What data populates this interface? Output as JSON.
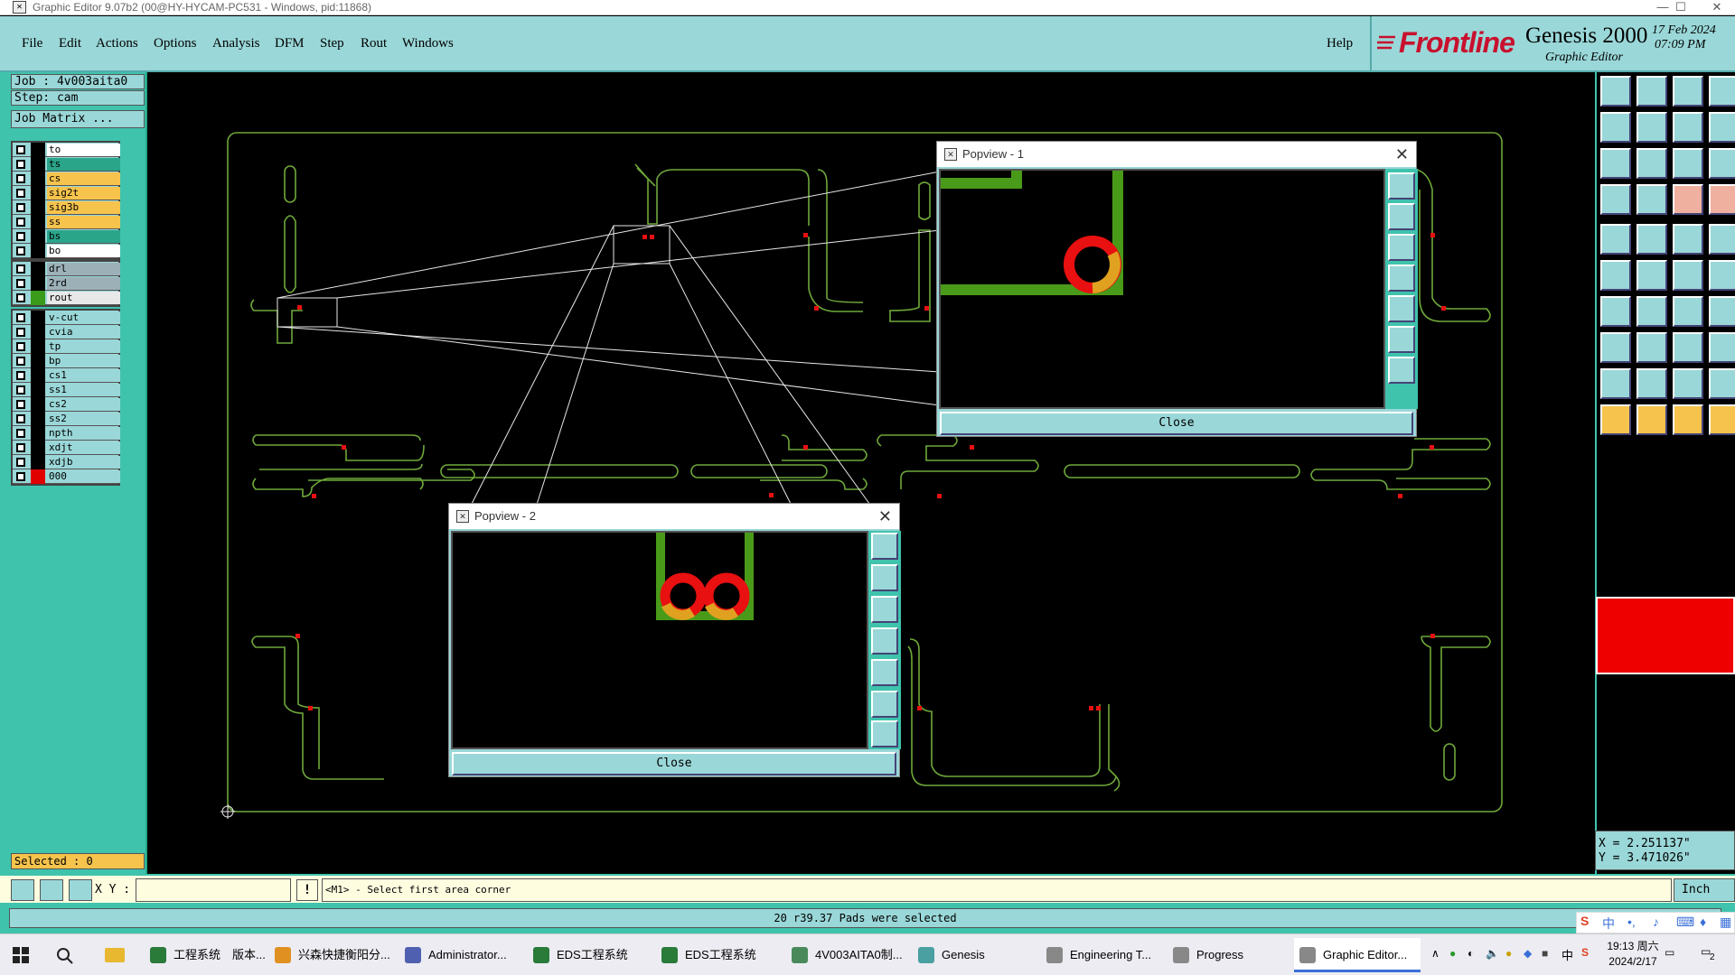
{
  "window": {
    "title": "Graphic Editor 9.07b2 (00@HY-HYCAM-PC531 - Windows, pid:11868)",
    "minimize": "—",
    "maximize": "☐",
    "close": "✕"
  },
  "menu": {
    "items": [
      "File",
      "Edit",
      "Actions",
      "Options",
      "Analysis",
      "DFM",
      "Step",
      "Rout",
      "Windows"
    ],
    "help": "Help"
  },
  "brand": {
    "logo": "Frontline",
    "product": "Genesis 2000",
    "subtitle": "Graphic Editor",
    "date": "17 Feb 2024",
    "time": "07:09 PM"
  },
  "job": {
    "job_line": "Job : 4v003aita0",
    "step_line": "Step: cam",
    "matrix_button": "Job Matrix ..."
  },
  "layers": {
    "group1": [
      {
        "name": "to",
        "color": "#ffffff"
      },
      {
        "name": "ts",
        "color": "#2aa58a"
      },
      {
        "name": "cs",
        "color": "#f6c34d"
      },
      {
        "name": "sig2t",
        "color": "#f6c34d"
      },
      {
        "name": "sig3b",
        "color": "#f6c34d"
      },
      {
        "name": "ss",
        "color": "#f6c34d"
      },
      {
        "name": "bs",
        "color": "#2aa58a"
      },
      {
        "name": "bo",
        "color": "#ffffff"
      }
    ],
    "group2": [
      {
        "name": "drl",
        "color": "#9cb0b8"
      },
      {
        "name": "2rd",
        "color": "#9cb0b8"
      },
      {
        "name": "rout",
        "color": "#e8e8e8",
        "mark": "#3a9a1a"
      }
    ],
    "group3": [
      {
        "name": "v-cut",
        "color": "#9ad7d8"
      },
      {
        "name": "cvia",
        "color": "#9ad7d8"
      },
      {
        "name": "tp",
        "color": "#9ad7d8"
      },
      {
        "name": "bp",
        "color": "#9ad7d8"
      },
      {
        "name": "cs1",
        "color": "#9ad7d8"
      },
      {
        "name": "ss1",
        "color": "#9ad7d8"
      },
      {
        "name": "cs2",
        "color": "#9ad7d8"
      },
      {
        "name": "ss2",
        "color": "#9ad7d8"
      },
      {
        "name": "npth",
        "color": "#9ad7d8"
      },
      {
        "name": "xdjt",
        "color": "#9ad7d8"
      },
      {
        "name": "xdjb",
        "color": "#9ad7d8"
      },
      {
        "name": "000",
        "color": "#9ad7d8",
        "mark": "#e00000"
      }
    ]
  },
  "selected": "Selected : 0",
  "status": {
    "xy_label": "X Y :",
    "xy_value": "",
    "exclaim": "!",
    "prompt": "<M1> - Select first area corner",
    "units": "Inch",
    "message": "20 r39.37 Pads were selected"
  },
  "coordinates": {
    "x": "X = 2.251137\"",
    "y": "Y = 3.471026\""
  },
  "popview1": {
    "title": "Popview - 1",
    "close_label": "Close"
  },
  "popview2": {
    "title": "Popview - 2",
    "close_label": "Close"
  },
  "colors": {
    "rout_line": "#6fa83a",
    "pad_red": "#e81010",
    "trace_green": "#4a9a1a",
    "pad_orange": "#e0a020",
    "panel_teal": "#3fc3ad",
    "panel_light": "#9ad7d8"
  },
  "taskbar": {
    "items": [
      {
        "label": "工程系统　版本...",
        "icon": "#2a7a3a"
      },
      {
        "label": "兴森快捷衡阳分...",
        "icon": "#e09020"
      },
      {
        "label": "Administrator...",
        "icon": "#5060b0"
      },
      {
        "label": "EDS工程系统",
        "icon": "#2a7a3a"
      },
      {
        "label": "EDS工程系统",
        "icon": "#2a7a3a"
      },
      {
        "label": "4V003AITA0制...",
        "icon": "#4a8a5a"
      },
      {
        "label": "Genesis",
        "icon": "#4aa0a0"
      },
      {
        "label": "Engineering T...",
        "icon": "#888888"
      },
      {
        "label": "Progress",
        "icon": "#888888"
      },
      {
        "label": "Graphic Editor...",
        "icon": "#888888"
      }
    ],
    "clock_time": "19:13 周六",
    "clock_date": "2024/2/17",
    "ime_lang": "中",
    "notification_count": "2"
  }
}
